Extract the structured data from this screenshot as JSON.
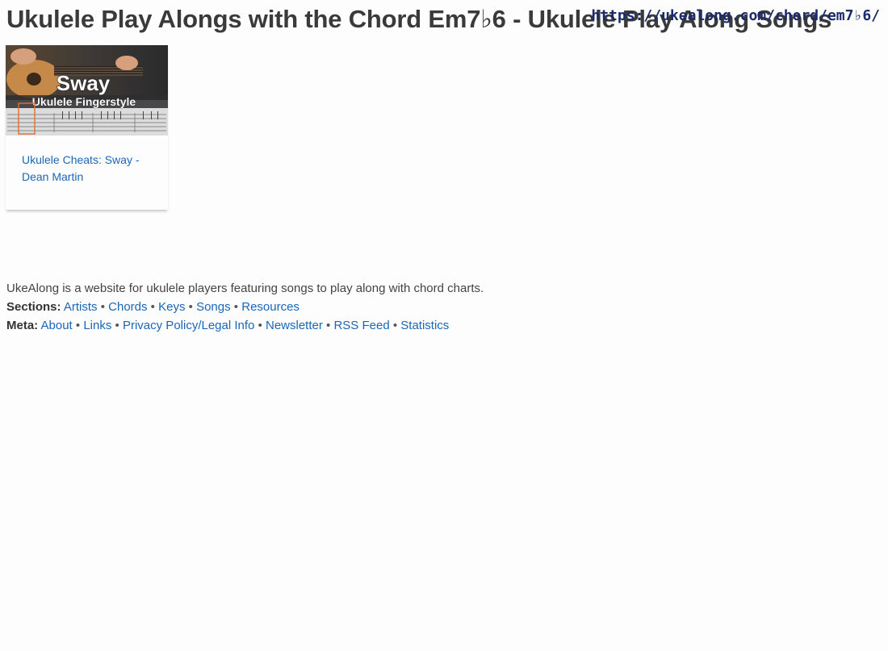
{
  "page": {
    "title": "Ukulele Play Alongs with the Chord Em7♭6 - Ukulele Play Along Songs",
    "url": "https://ukealong.com/chord/em7♭6/"
  },
  "card": {
    "thumbnail": {
      "title_text": "Sway",
      "subtitle_text": "Ukulele Fingerstyle"
    },
    "link_label": "Ukulele Cheats: Sway - Dean Martin"
  },
  "footer": {
    "description": "UkeAlong is a website for ukulele players featuring songs to play along with chord charts.",
    "sections_label": "Sections:",
    "sections": [
      "Artists",
      "Chords",
      "Keys",
      "Songs",
      "Resources"
    ],
    "meta_label": "Meta:",
    "meta": [
      "About",
      "Links",
      "Privacy Policy/Legal Info",
      "Newsletter",
      "RSS Feed",
      "Statistics"
    ],
    "separator": "•"
  },
  "colors": {
    "link": "#1a66b8",
    "text": "#444444",
    "url_overlay": "#1a2a6c"
  }
}
